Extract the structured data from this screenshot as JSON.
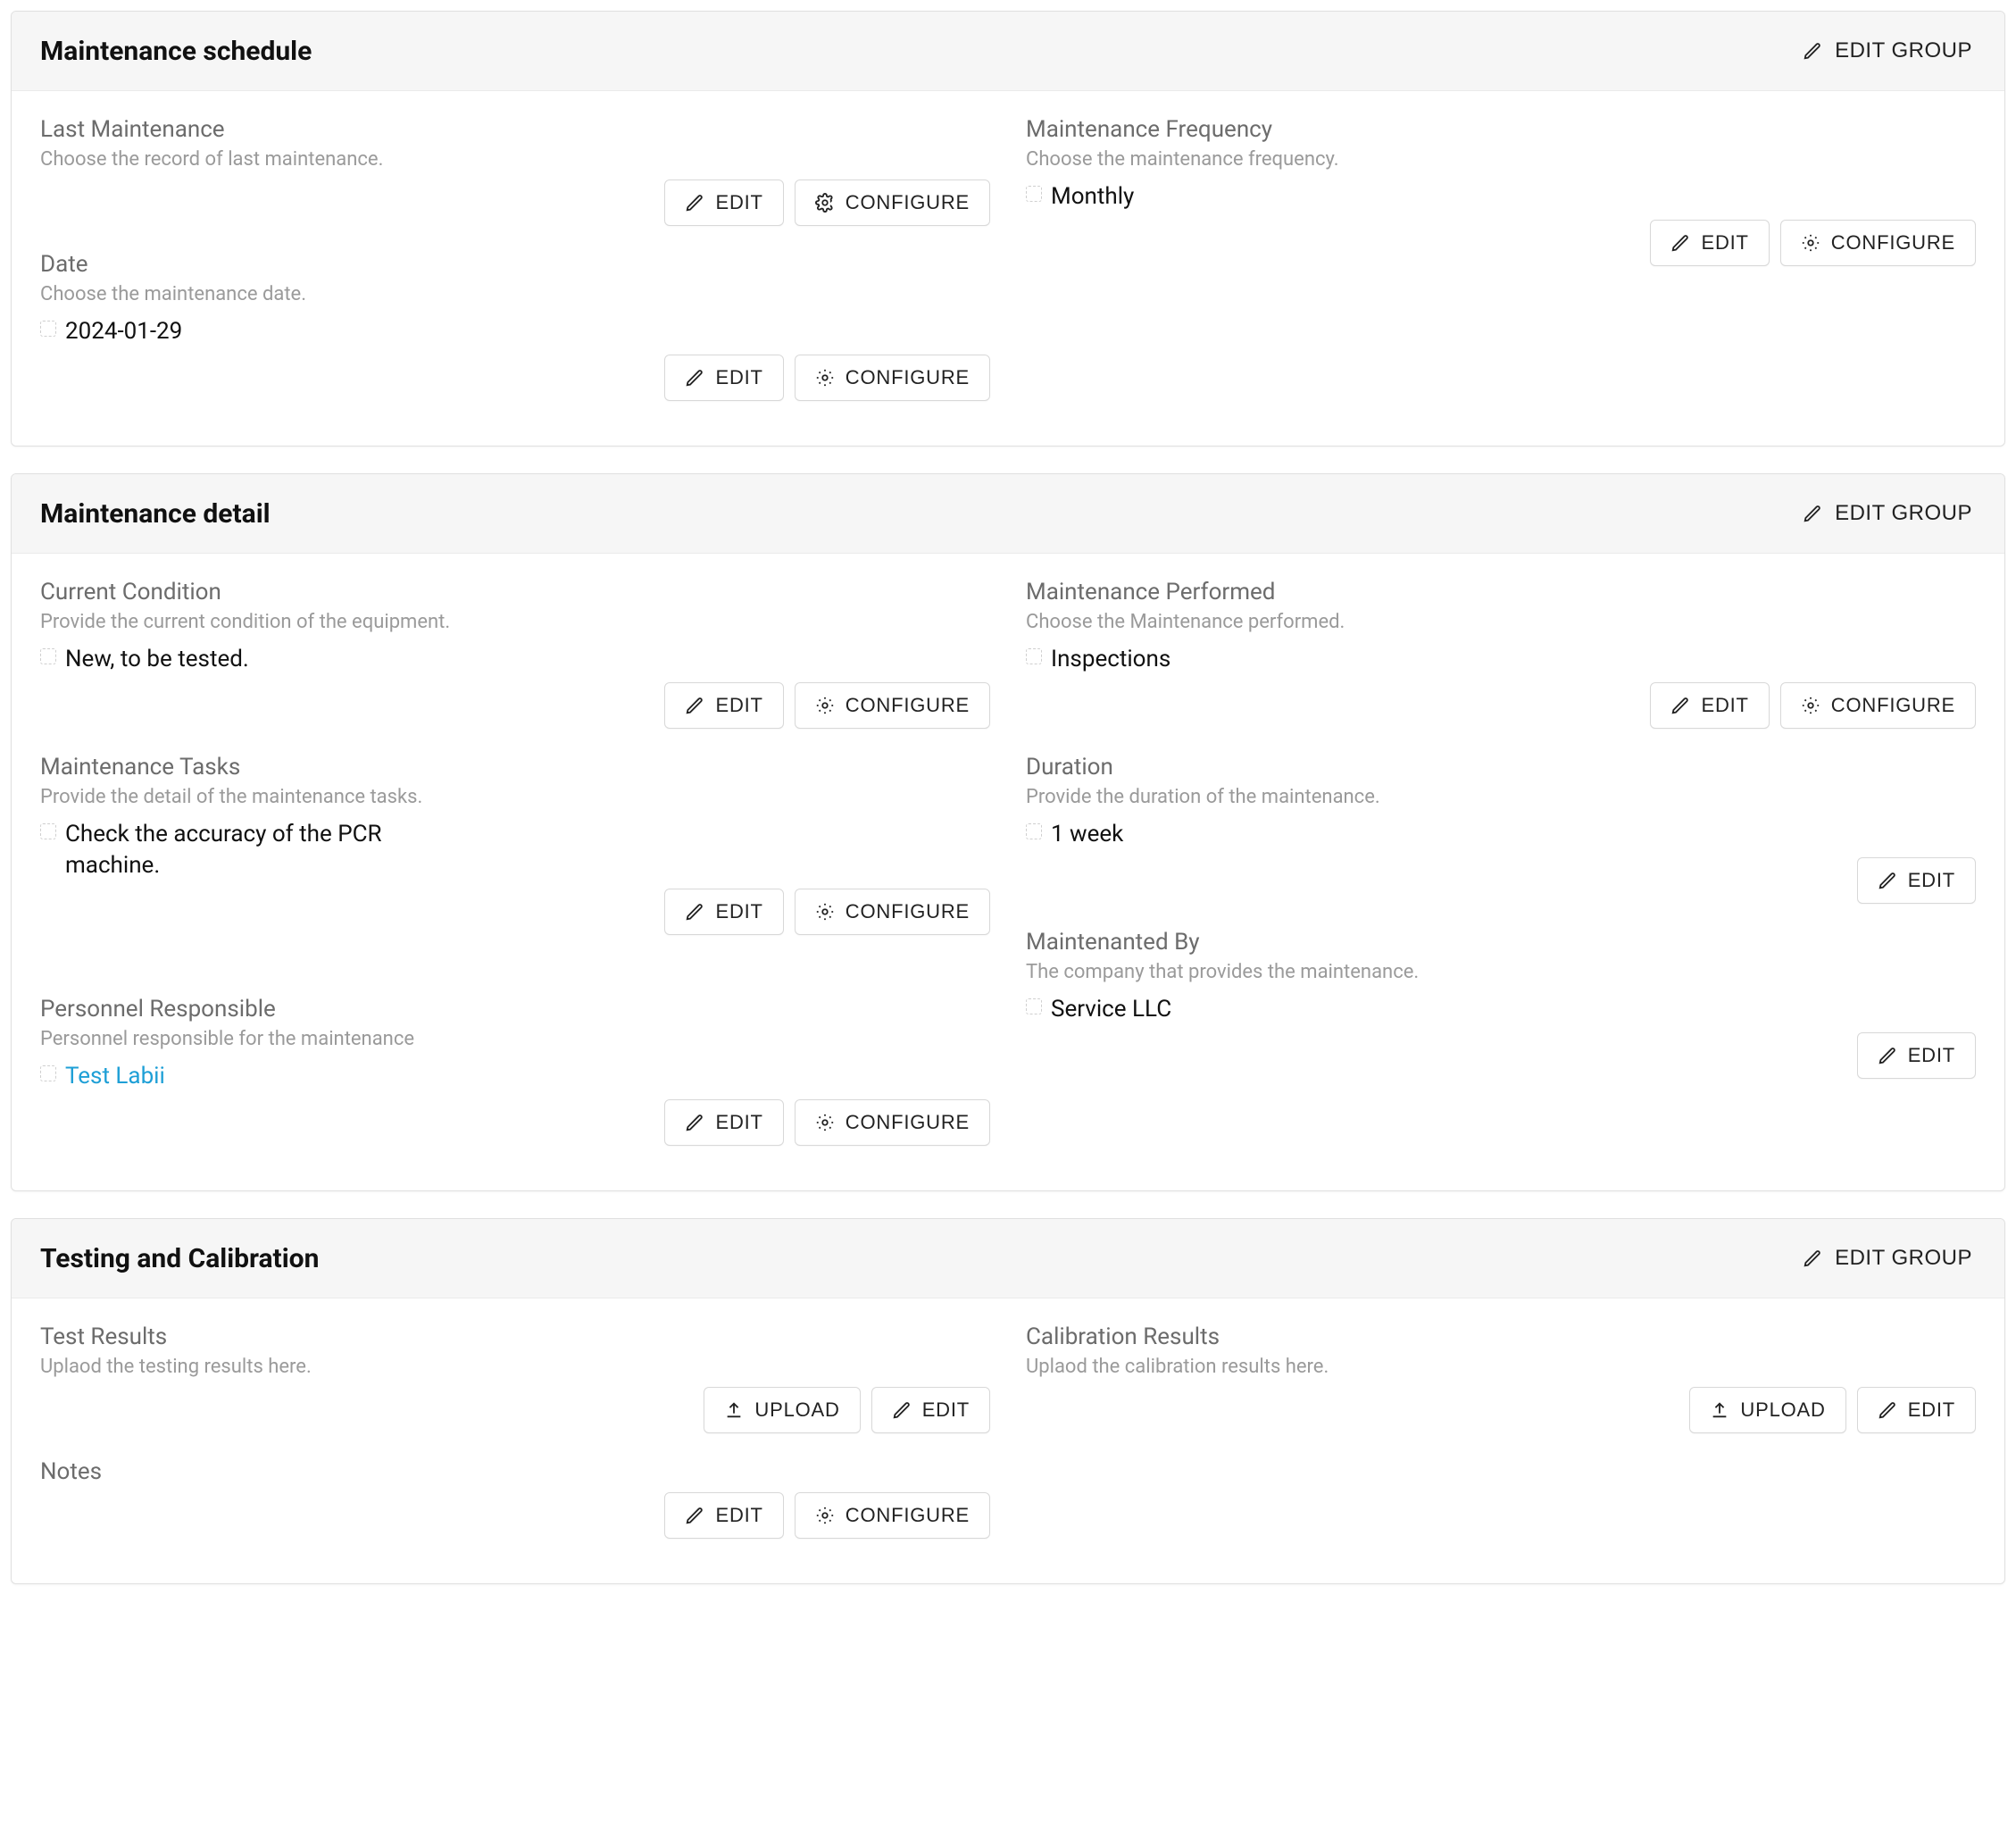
{
  "buttons": {
    "edit_group": "EDIT GROUP",
    "edit": "EDIT",
    "configure": "CONFIGURE",
    "upload": "UPLOAD"
  },
  "groups": {
    "schedule": {
      "title": "Maintenance schedule",
      "last_maintenance": {
        "label": "Last Maintenance",
        "hint": "Choose the record of last maintenance."
      },
      "date": {
        "label": "Date",
        "hint": "Choose the maintenance date.",
        "value": "2024-01-29"
      },
      "frequency": {
        "label": "Maintenance Frequency",
        "hint": "Choose the maintenance frequency.",
        "value": "Monthly"
      }
    },
    "detail": {
      "title": "Maintenance detail",
      "current_condition": {
        "label": "Current Condition",
        "hint": "Provide the current condition of the equipment.",
        "value": "New, to be tested."
      },
      "maintenance_tasks": {
        "label": "Maintenance Tasks",
        "hint": "Provide the detail of the maintenance tasks.",
        "value": "Check the accuracy of the PCR machine."
      },
      "personnel": {
        "label": "Personnel Responsible",
        "hint": "Personnel responsible for the maintenance",
        "value": "Test Labii"
      },
      "maintenance_performed": {
        "label": "Maintenance Performed",
        "hint": "Choose the Maintenance performed.",
        "value": "Inspections"
      },
      "duration": {
        "label": "Duration",
        "hint": "Provide the duration of the maintenance.",
        "value": "1 week"
      },
      "maintained_by": {
        "label": "Maintenanted By",
        "hint": "The company that provides the maintenance.",
        "value": "Service LLC"
      }
    },
    "testing": {
      "title": "Testing and Calibration",
      "test_results": {
        "label": "Test Results",
        "hint": "Uplaod the testing results here."
      },
      "notes": {
        "label": "Notes"
      },
      "calibration_results": {
        "label": "Calibration Results",
        "hint": "Uplaod the calibration results here."
      }
    }
  }
}
